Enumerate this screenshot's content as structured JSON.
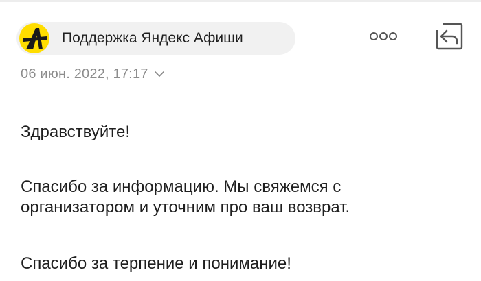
{
  "header": {
    "sender_name": "Поддержка Яндекс Афиши",
    "avatar_icon": "yandex-afisha-logo-icon",
    "more_icon": "more-dots-icon",
    "reply_icon": "reply-icon"
  },
  "message": {
    "date": "06 июн. 2022, 17:17",
    "date_expand_icon": "chevron-down-icon",
    "greeting": "Здравствуйте!",
    "info_line1": "Спасибо за информацию. Мы свяжемся с",
    "info_line2": "организатором и уточним про ваш возврат.",
    "thanks": "Спасибо за терпение и понимание!"
  },
  "colors": {
    "brand_yellow": "#ffdd00",
    "text": "#1f1f1f",
    "muted": "#8c8c8c",
    "chip_bg": "#f1f1f1"
  }
}
